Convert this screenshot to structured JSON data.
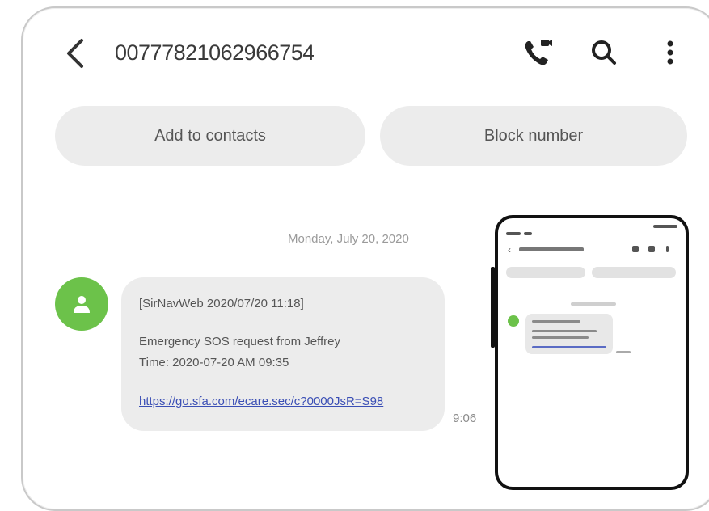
{
  "header": {
    "title": "00777821062966754",
    "back_icon": "chevron-left-icon",
    "call_icon": "video-call-icon",
    "search_icon": "search-icon",
    "more_icon": "more-vertical-icon"
  },
  "actions": {
    "add_label": "Add to contacts",
    "block_label": "Block number"
  },
  "conversation": {
    "date": "Monday, July 20, 2020",
    "messages": [
      {
        "line1": "[SirNavWeb 2020/07/20 11:18]",
        "line2": "Emergency SOS request from Jeffrey",
        "line3": "Time: 2020-07-20 AM 09:35",
        "link": "https://go.sfa.com/ecare.sec/c?0000JsR=S98",
        "time": "9:06"
      }
    ]
  },
  "colors": {
    "accent_green": "#6cc24a",
    "link_blue": "#3b4fb5",
    "pill_bg": "#ececec"
  }
}
